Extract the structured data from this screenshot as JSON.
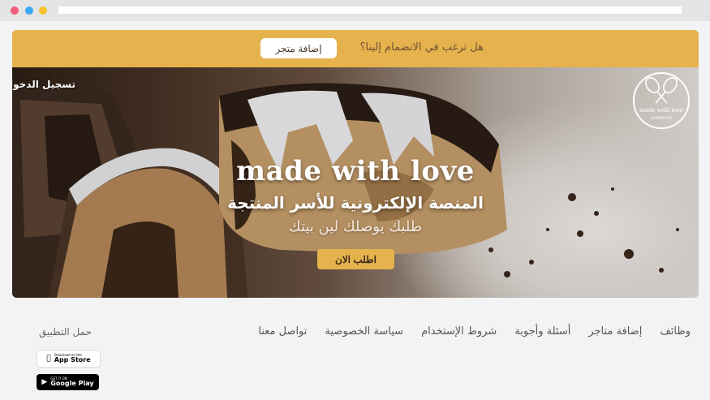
{
  "header": {
    "join_text": "هل ترغب في الانضمام إلينا؟",
    "add_store_label": "إضافة متجر"
  },
  "hero": {
    "login_label": "تسجيل الدخول",
    "logo_text": "made with love",
    "logo_sub": "HOMEMADE",
    "title": "made with love",
    "subtitle": "المنصة الإلكترونية للأسر المنتجة",
    "tagline": "طلبك يوصلك لين بيتك",
    "order_label": "اطلب الان"
  },
  "footer": {
    "nav": [
      "تواصل معنا",
      "سياسة الخصوصية",
      "شروط الإستخدام",
      "أسئلة وأجوبة",
      "إضافة متاجر",
      "وظائف"
    ],
    "download_title": "حمل التطبيق",
    "app_store": {
      "small": "Download on the",
      "name": "App Store",
      "icon": "apple-icon"
    },
    "google_play": {
      "small": "GET IT ON",
      "name": "Google Play",
      "icon": "play-icon"
    }
  },
  "colors": {
    "accent": "#e5b24e",
    "background": "#f3f3f3"
  }
}
